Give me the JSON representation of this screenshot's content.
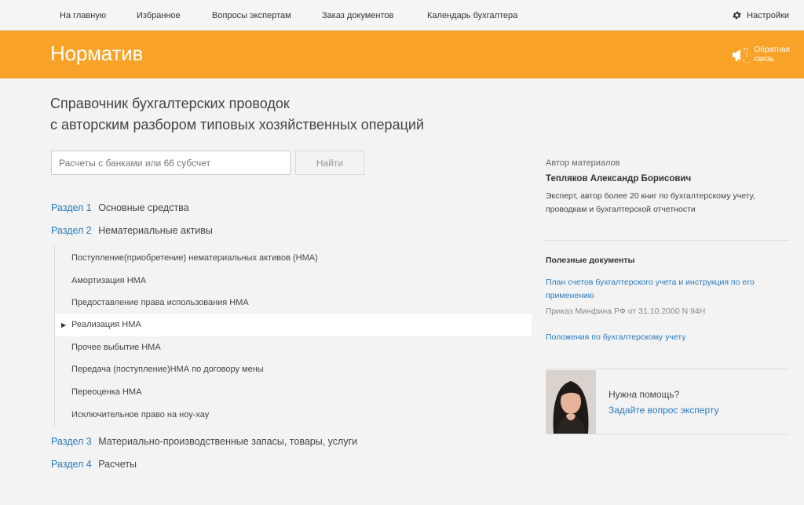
{
  "nav": {
    "links": [
      "На главную",
      "Избранное",
      "Вопросы экспертам",
      "Заказ  документов",
      "Календарь бухгалтера"
    ],
    "settings_label": "Настройки"
  },
  "header": {
    "brand": "Норматив",
    "feedback_line1": "Обратная",
    "feedback_line2": "связь",
    "accent_color": "#f8a327"
  },
  "page": {
    "title_line1": "Справочник бухгалтерских проводок",
    "title_line2": "с авторским разбором типовых хозяйственных операций"
  },
  "search": {
    "placeholder": "Расчеты с банками или 66 субсчет",
    "value": "",
    "button_label": "Найти"
  },
  "sections": [
    {
      "num": "Раздел 1",
      "name": "Основные средства"
    },
    {
      "num": "Раздел 2",
      "name": "Нематериальные активы"
    },
    {
      "num": "Раздел 3",
      "name": "Материально-производственные запасы, товары, услуги"
    },
    {
      "num": "Раздел 4",
      "name": "Расчеты"
    }
  ],
  "subsections": [
    "Поступление(приобретение) нематериальных активов (НМА)",
    "Амортизация НМА",
    "Предоставление права использования НМА",
    "Реализация НМА",
    "Прочее выбытие НМА",
    "Передача (поступление)НМА по договору мены",
    "Переоценка НМА",
    "Исключительное право на ноу-хау"
  ],
  "active_subsection": "Реализация НМА",
  "author": {
    "label": "Автор материалов",
    "name": "Тепляков Александр Борисович",
    "desc_line1": "Эксперт, автор более 20 книг по бухгалтерскому учету,",
    "desc_line2": "проводкам и бухгалтерской отчетности"
  },
  "docs": {
    "title": "Полезные документы",
    "doc1_line1": "План счетов бухгалтерского учета и инструкция по его",
    "doc1_line2": "применению",
    "doc1_sub": "Приказ Минфина РФ от 31.10.2000 N 94Н",
    "doc2": "Положения по бухгалтерскому учету"
  },
  "help": {
    "question": "Нужна помощь?",
    "link": "Задайте вопрос эксперту"
  },
  "icons": {
    "settings": "gear-icon",
    "feedback": "megaphone-icon",
    "active_marker": "triangle-right-icon"
  }
}
